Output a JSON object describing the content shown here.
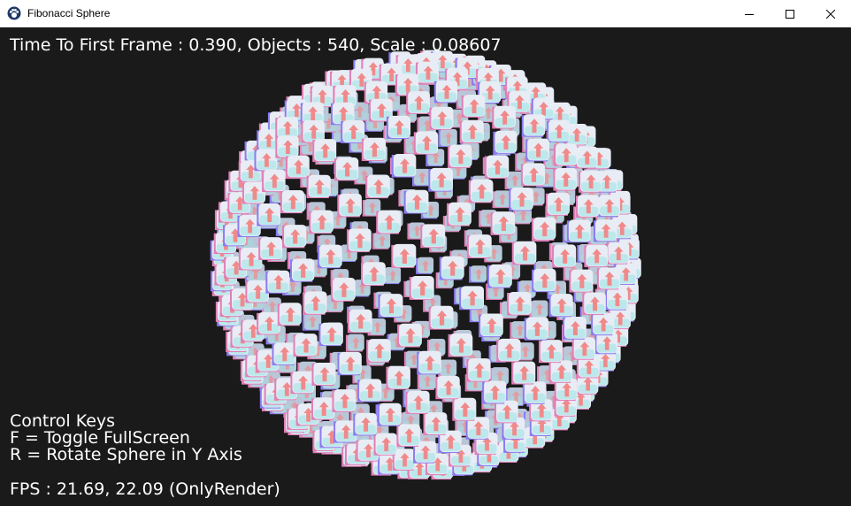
{
  "window": {
    "title": "Fibonacci Sphere",
    "icon": "paw-icon",
    "controls": [
      "minimize-icon",
      "maximize-icon",
      "close-icon"
    ]
  },
  "hud": {
    "stats": "Time To First Frame : 0.390, Objects : 540, Scale : 0.08607",
    "keys_title": "Control Keys",
    "key_f": "F = Toggle FullScreen",
    "key_r": "R = Rotate Sphere in Y Axis",
    "fps": "FPS : 21.69, 22.09 (OnlyRender)"
  },
  "scene": {
    "object_count": 540,
    "background": "#1a1a1a",
    "colors": {
      "cube_face": "#e8ecf4",
      "cube_shade": "#b9c6d8",
      "cube_cyan": "#9fe6e6",
      "arrow": "#f08a8a",
      "edge_pink": "#e080b8",
      "edge_violet": "#8c7cf0"
    }
  }
}
